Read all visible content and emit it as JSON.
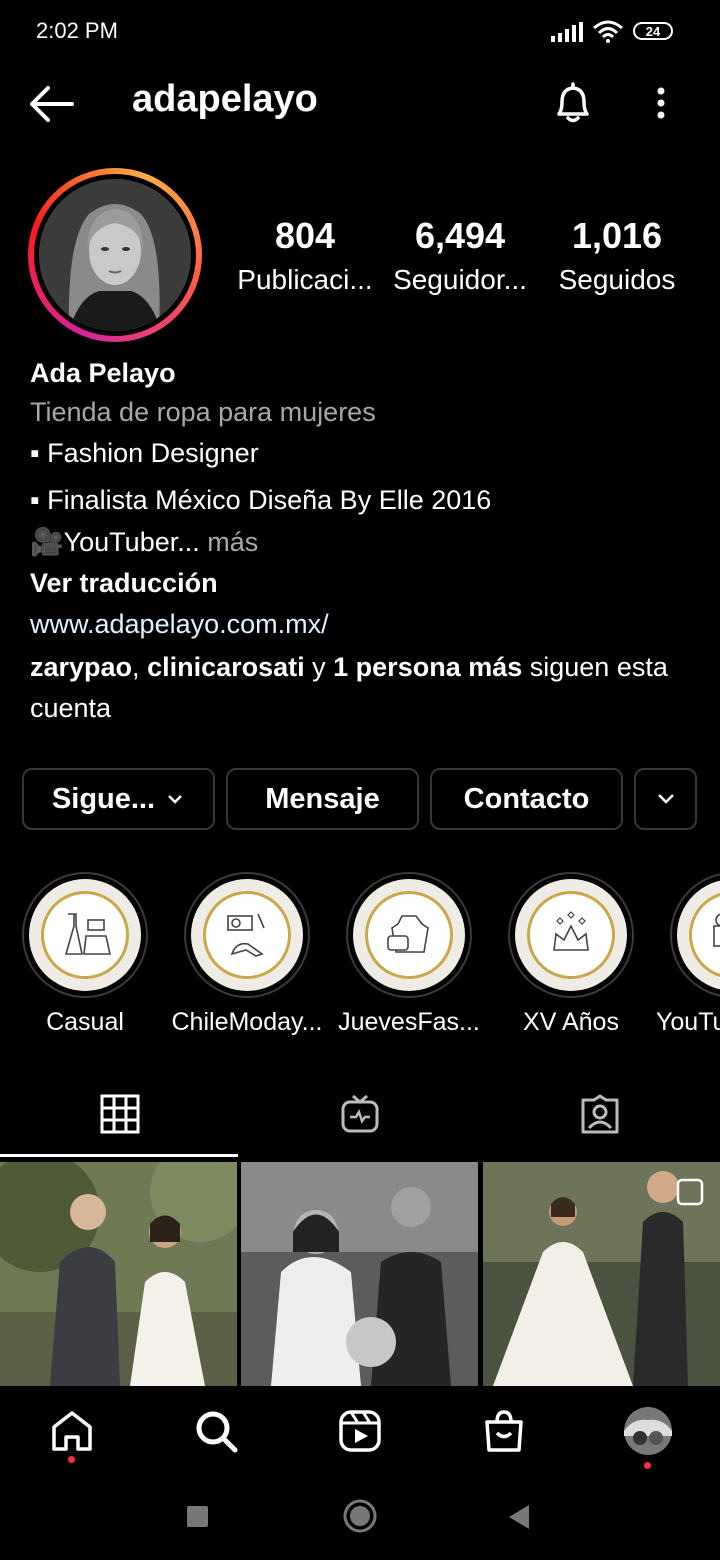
{
  "status_bar": {
    "time": "2:02 PM",
    "battery": "24"
  },
  "header": {
    "username": "adapelayo"
  },
  "profile": {
    "stats": [
      {
        "value": "804",
        "label": "Publicaci..."
      },
      {
        "value": "6,494",
        "label": "Seguidor..."
      },
      {
        "value": "1,016",
        "label": "Seguidos"
      }
    ],
    "name": "Ada Pelayo",
    "category": "Tienda de ropa para mujeres",
    "bio_lines": [
      "▪ Fashion Designer",
      "▪ Finalista México Diseña By Elle 2016",
      "🎥YouTuber..."
    ],
    "bio_more": " más",
    "translate": "Ver traducción",
    "link": "www.adapelayo.com.mx/",
    "followed_by": {
      "user1": "zarypao",
      "sep1": ", ",
      "user2": "clinicarosati",
      "sep2": " y ",
      "others": "1 persona más",
      "suffix": " siguen esta cuenta"
    }
  },
  "actions": {
    "following": "Sigue...",
    "message": "Mensaje",
    "contact": "Contacto"
  },
  "highlights": [
    {
      "label": "Casual",
      "icon": "dress-icon"
    },
    {
      "label": "ChileModay...",
      "icon": "makeup-heels-icon"
    },
    {
      "label": "JuevesFas...",
      "icon": "bag-dress-icon"
    },
    {
      "label": "XV Años",
      "icon": "tiara-icon"
    },
    {
      "label": "YouTu",
      "icon": "camera-icon"
    }
  ],
  "tabs": [
    "grid-icon",
    "igtv-icon",
    "tagged-icon"
  ],
  "nav": [
    "home-icon",
    "search-icon",
    "reels-icon",
    "shop-icon",
    "profile-avatar"
  ],
  "colors": {
    "background": "#000000",
    "link": "#e0f1ff",
    "secondary": "#a8a8a8",
    "border": "#363636",
    "notification": "#ff3040"
  }
}
